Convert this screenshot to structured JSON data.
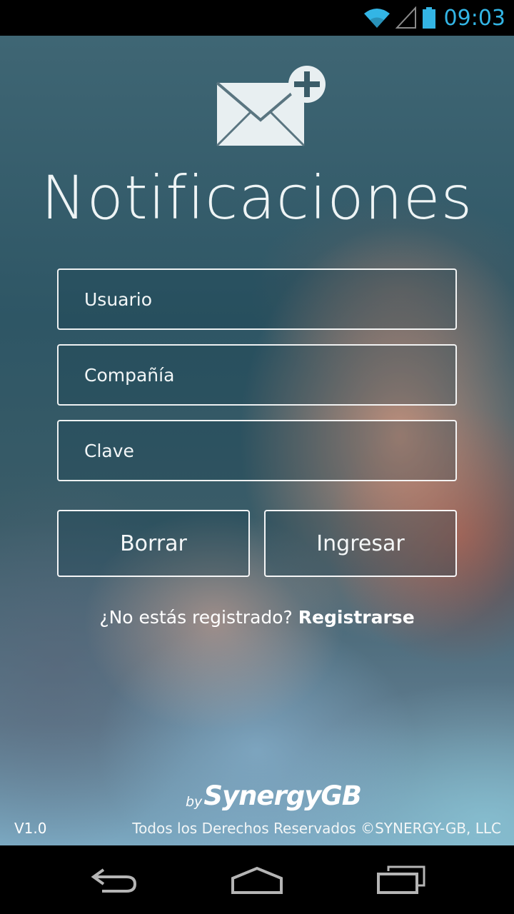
{
  "status_bar": {
    "time": "09:03",
    "icons": [
      "wifi-icon",
      "cell-signal-icon",
      "battery-icon"
    ],
    "accent_color": "#33b5e5"
  },
  "app": {
    "logo_icon": "envelope-plus-icon",
    "title": "Notificaciones",
    "form": {
      "user_placeholder": "Usuario",
      "company_placeholder": "Compañía",
      "password_placeholder": "Clave",
      "clear_label": "Borrar",
      "login_label": "Ingresar"
    },
    "register": {
      "prompt": "¿No estás registrado?",
      "link": "Registrarse"
    },
    "brand": {
      "by": "by",
      "name": "SynergyGB"
    },
    "version": "V1.0",
    "copyright": "Todos los Derechos Reservados ©SYNERGY-GB, LLC"
  },
  "nav_bar": {
    "icons": [
      "back-icon",
      "home-icon",
      "recent-apps-icon"
    ]
  }
}
